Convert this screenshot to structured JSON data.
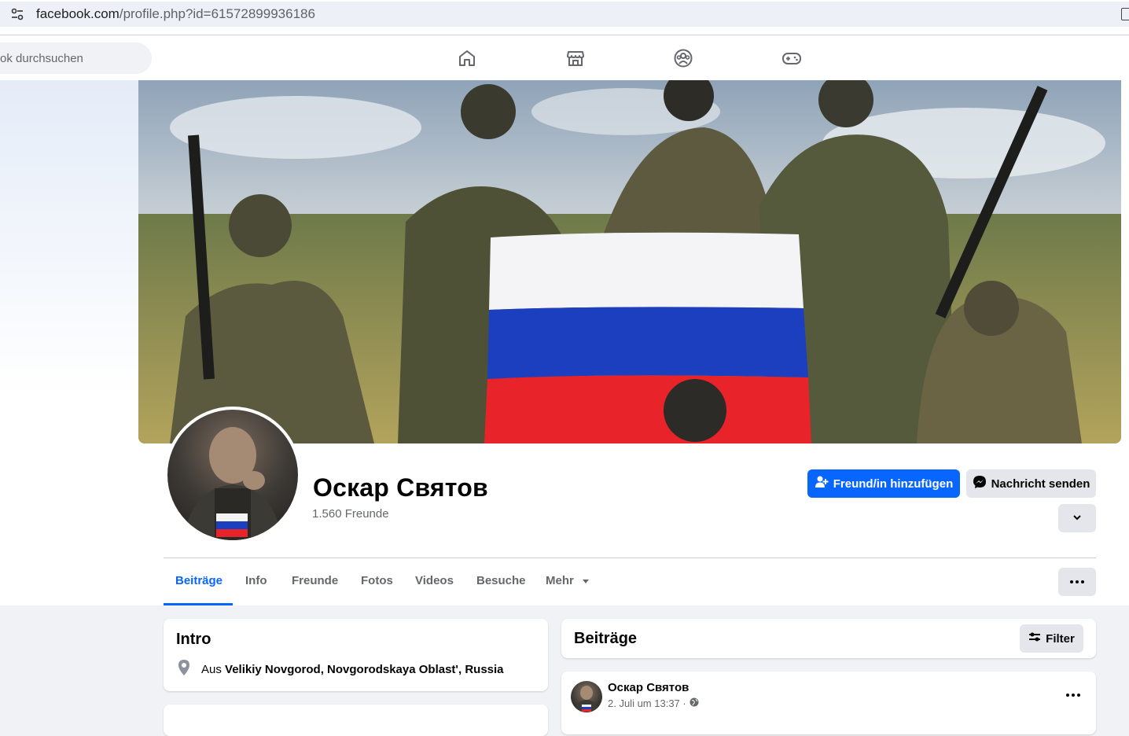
{
  "browser": {
    "url_domain": "facebook.com",
    "url_path": "/profile.php?id=61572899936186"
  },
  "nav": {
    "search_placeholder": "ok durchsuchen",
    "icons": [
      "home-icon",
      "marketplace-icon",
      "groups-icon",
      "gaming-icon"
    ]
  },
  "profile": {
    "name": "Оскар Святов",
    "friends": "1.560 Freunde",
    "add_friend_label": "Freund/in hinzufügen",
    "message_label": "Nachricht senden"
  },
  "tabs": [
    {
      "label": "Beiträge",
      "active": true
    },
    {
      "label": "Info"
    },
    {
      "label": "Freunde"
    },
    {
      "label": "Fotos"
    },
    {
      "label": "Videos"
    },
    {
      "label": "Besuche"
    },
    {
      "label": "Mehr"
    }
  ],
  "intro": {
    "title": "Intro",
    "prefix": "Aus ",
    "location": "Velikiy Novgorod, Novgorodskaya Oblast', Russia"
  },
  "posts": {
    "title": "Beiträge",
    "filter_label": "Filter",
    "first_post": {
      "author": "Оскар Святов",
      "date": "2. Juli um 13:37 ·"
    }
  },
  "colors": {
    "accent": "#0866ff",
    "page_bg": "#f0f2f5",
    "flag_white": "#f4f4f6",
    "flag_blue": "#1c3fbf",
    "flag_red": "#e8232a"
  }
}
